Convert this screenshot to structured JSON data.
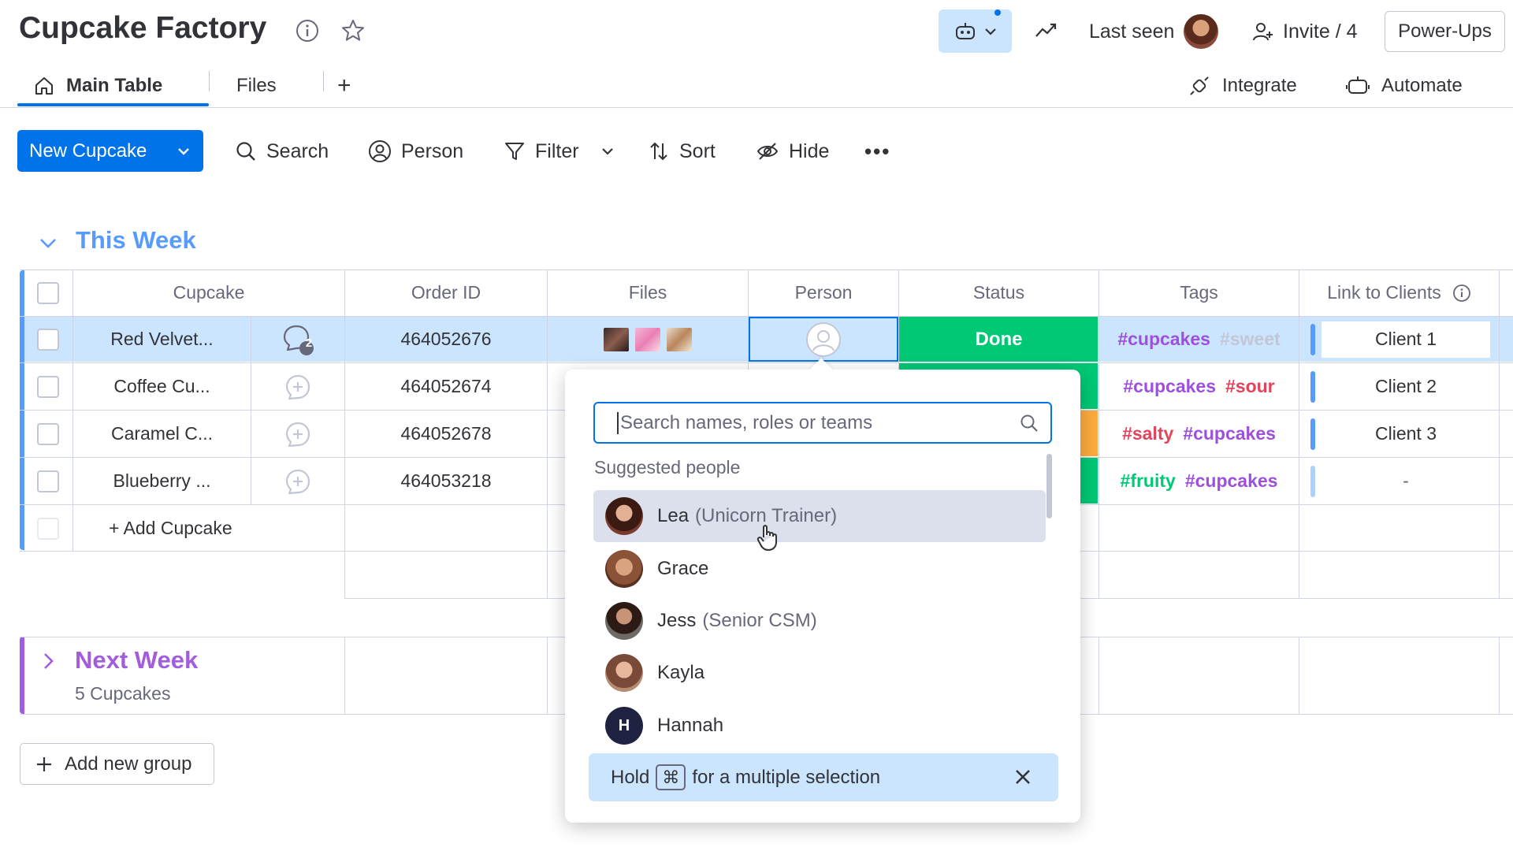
{
  "header": {
    "title": "Cupcake Factory",
    "last_seen_label": "Last seen",
    "invite_label": "Invite / 4",
    "powerups_label": "Power-Ups"
  },
  "tabs": {
    "items": [
      {
        "label": "Main Table",
        "icon": "home-icon",
        "active": true
      },
      {
        "label": "Files",
        "active": false
      }
    ],
    "add_label": "+",
    "integrate_label": "Integrate",
    "automate_label": "Automate"
  },
  "toolbar": {
    "new_label": "New Cupcake",
    "search_label": "Search",
    "person_label": "Person",
    "filter_label": "Filter",
    "sort_label": "Sort",
    "hide_label": "Hide",
    "more_label": "•••"
  },
  "group_this_week": {
    "title": "This Week",
    "color": "#579bfc",
    "columns": [
      "Cupcake",
      "Order ID",
      "Files",
      "Person",
      "Status",
      "Tags",
      "Link to Clients"
    ],
    "rows": [
      {
        "name": "Red Velvet...",
        "updates": "2",
        "order_id": "464052676",
        "status": "Done",
        "status_color": "#00c875",
        "tag_a": "#cupcakes",
        "tag_b": "#sweet",
        "client": "Client 1"
      },
      {
        "name": "Coffee Cu...",
        "order_id": "464052674",
        "status": "",
        "status_color": "#00c875",
        "tag_a": "#cupcakes",
        "tag_b": "#sour",
        "client": "Client 2"
      },
      {
        "name": "Caramel C...",
        "order_id": "464052678",
        "status": "",
        "status_color": "#fdab3d",
        "tag_a": "#salty",
        "tag_b": "#cupcakes",
        "client": "Client 3"
      },
      {
        "name": "Blueberry ...",
        "order_id": "464053218",
        "status": "",
        "status_color": "#00c875",
        "tag_a": "#fruity",
        "tag_b": "#cupcakes",
        "client": "-"
      }
    ],
    "add_item_label": "+ Add Cupcake"
  },
  "group_next_week": {
    "title": "Next Week",
    "color": "#a25ddc",
    "count_label": "5 Cupcakes"
  },
  "add_group_label": "Add new group",
  "person_picker": {
    "search_placeholder": "Search names, roles or teams",
    "section_label": "Suggested people",
    "people": [
      {
        "name": "Lea",
        "role": "(Unicorn Trainer)"
      },
      {
        "name": "Grace",
        "role": ""
      },
      {
        "name": "Jess",
        "role": "(Senior CSM)"
      },
      {
        "name": "Kayla",
        "role": ""
      },
      {
        "name": "Hannah",
        "role": "",
        "initial": "H"
      }
    ],
    "hint_prefix": "Hold",
    "hint_key": "⌘",
    "hint_suffix": "for a multiple selection"
  }
}
